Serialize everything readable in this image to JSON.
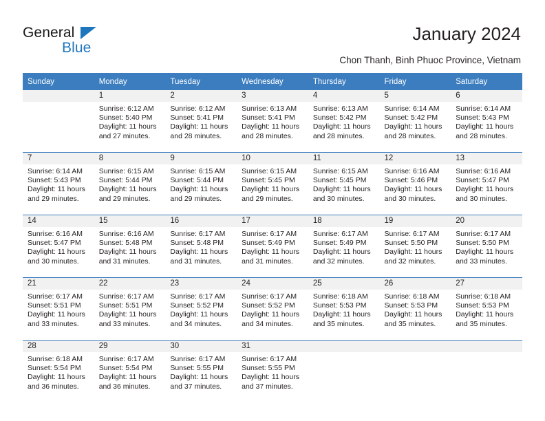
{
  "brand": {
    "name_part1": "General",
    "name_part2": "Blue",
    "triangle_color": "#1e76bd"
  },
  "header": {
    "title": "January 2024",
    "subtitle": "Chon Thanh, Binh Phuoc Province, Vietnam"
  },
  "theme": {
    "header_blue": "#3b7dbf",
    "daynum_band": "#f1f1f1",
    "text": "#231f20"
  },
  "calendar": {
    "weekday_headers": [
      "Sunday",
      "Monday",
      "Tuesday",
      "Wednesday",
      "Thursday",
      "Friday",
      "Saturday"
    ],
    "weeks": [
      [
        {
          "day": "",
          "sunrise": "",
          "sunset": "",
          "daylight1": "",
          "daylight2": ""
        },
        {
          "day": "1",
          "sunrise": "Sunrise: 6:12 AM",
          "sunset": "Sunset: 5:40 PM",
          "daylight1": "Daylight: 11 hours",
          "daylight2": "and 27 minutes."
        },
        {
          "day": "2",
          "sunrise": "Sunrise: 6:12 AM",
          "sunset": "Sunset: 5:41 PM",
          "daylight1": "Daylight: 11 hours",
          "daylight2": "and 28 minutes."
        },
        {
          "day": "3",
          "sunrise": "Sunrise: 6:13 AM",
          "sunset": "Sunset: 5:41 PM",
          "daylight1": "Daylight: 11 hours",
          "daylight2": "and 28 minutes."
        },
        {
          "day": "4",
          "sunrise": "Sunrise: 6:13 AM",
          "sunset": "Sunset: 5:42 PM",
          "daylight1": "Daylight: 11 hours",
          "daylight2": "and 28 minutes."
        },
        {
          "day": "5",
          "sunrise": "Sunrise: 6:14 AM",
          "sunset": "Sunset: 5:42 PM",
          "daylight1": "Daylight: 11 hours",
          "daylight2": "and 28 minutes."
        },
        {
          "day": "6",
          "sunrise": "Sunrise: 6:14 AM",
          "sunset": "Sunset: 5:43 PM",
          "daylight1": "Daylight: 11 hours",
          "daylight2": "and 28 minutes."
        }
      ],
      [
        {
          "day": "7",
          "sunrise": "Sunrise: 6:14 AM",
          "sunset": "Sunset: 5:43 PM",
          "daylight1": "Daylight: 11 hours",
          "daylight2": "and 29 minutes."
        },
        {
          "day": "8",
          "sunrise": "Sunrise: 6:15 AM",
          "sunset": "Sunset: 5:44 PM",
          "daylight1": "Daylight: 11 hours",
          "daylight2": "and 29 minutes."
        },
        {
          "day": "9",
          "sunrise": "Sunrise: 6:15 AM",
          "sunset": "Sunset: 5:44 PM",
          "daylight1": "Daylight: 11 hours",
          "daylight2": "and 29 minutes."
        },
        {
          "day": "10",
          "sunrise": "Sunrise: 6:15 AM",
          "sunset": "Sunset: 5:45 PM",
          "daylight1": "Daylight: 11 hours",
          "daylight2": "and 29 minutes."
        },
        {
          "day": "11",
          "sunrise": "Sunrise: 6:15 AM",
          "sunset": "Sunset: 5:45 PM",
          "daylight1": "Daylight: 11 hours",
          "daylight2": "and 30 minutes."
        },
        {
          "day": "12",
          "sunrise": "Sunrise: 6:16 AM",
          "sunset": "Sunset: 5:46 PM",
          "daylight1": "Daylight: 11 hours",
          "daylight2": "and 30 minutes."
        },
        {
          "day": "13",
          "sunrise": "Sunrise: 6:16 AM",
          "sunset": "Sunset: 5:47 PM",
          "daylight1": "Daylight: 11 hours",
          "daylight2": "and 30 minutes."
        }
      ],
      [
        {
          "day": "14",
          "sunrise": "Sunrise: 6:16 AM",
          "sunset": "Sunset: 5:47 PM",
          "daylight1": "Daylight: 11 hours",
          "daylight2": "and 30 minutes."
        },
        {
          "day": "15",
          "sunrise": "Sunrise: 6:16 AM",
          "sunset": "Sunset: 5:48 PM",
          "daylight1": "Daylight: 11 hours",
          "daylight2": "and 31 minutes."
        },
        {
          "day": "16",
          "sunrise": "Sunrise: 6:17 AM",
          "sunset": "Sunset: 5:48 PM",
          "daylight1": "Daylight: 11 hours",
          "daylight2": "and 31 minutes."
        },
        {
          "day": "17",
          "sunrise": "Sunrise: 6:17 AM",
          "sunset": "Sunset: 5:49 PM",
          "daylight1": "Daylight: 11 hours",
          "daylight2": "and 31 minutes."
        },
        {
          "day": "18",
          "sunrise": "Sunrise: 6:17 AM",
          "sunset": "Sunset: 5:49 PM",
          "daylight1": "Daylight: 11 hours",
          "daylight2": "and 32 minutes."
        },
        {
          "day": "19",
          "sunrise": "Sunrise: 6:17 AM",
          "sunset": "Sunset: 5:50 PM",
          "daylight1": "Daylight: 11 hours",
          "daylight2": "and 32 minutes."
        },
        {
          "day": "20",
          "sunrise": "Sunrise: 6:17 AM",
          "sunset": "Sunset: 5:50 PM",
          "daylight1": "Daylight: 11 hours",
          "daylight2": "and 33 minutes."
        }
      ],
      [
        {
          "day": "21",
          "sunrise": "Sunrise: 6:17 AM",
          "sunset": "Sunset: 5:51 PM",
          "daylight1": "Daylight: 11 hours",
          "daylight2": "and 33 minutes."
        },
        {
          "day": "22",
          "sunrise": "Sunrise: 6:17 AM",
          "sunset": "Sunset: 5:51 PM",
          "daylight1": "Daylight: 11 hours",
          "daylight2": "and 33 minutes."
        },
        {
          "day": "23",
          "sunrise": "Sunrise: 6:17 AM",
          "sunset": "Sunset: 5:52 PM",
          "daylight1": "Daylight: 11 hours",
          "daylight2": "and 34 minutes."
        },
        {
          "day": "24",
          "sunrise": "Sunrise: 6:17 AM",
          "sunset": "Sunset: 5:52 PM",
          "daylight1": "Daylight: 11 hours",
          "daylight2": "and 34 minutes."
        },
        {
          "day": "25",
          "sunrise": "Sunrise: 6:18 AM",
          "sunset": "Sunset: 5:53 PM",
          "daylight1": "Daylight: 11 hours",
          "daylight2": "and 35 minutes."
        },
        {
          "day": "26",
          "sunrise": "Sunrise: 6:18 AM",
          "sunset": "Sunset: 5:53 PM",
          "daylight1": "Daylight: 11 hours",
          "daylight2": "and 35 minutes."
        },
        {
          "day": "27",
          "sunrise": "Sunrise: 6:18 AM",
          "sunset": "Sunset: 5:53 PM",
          "daylight1": "Daylight: 11 hours",
          "daylight2": "and 35 minutes."
        }
      ],
      [
        {
          "day": "28",
          "sunrise": "Sunrise: 6:18 AM",
          "sunset": "Sunset: 5:54 PM",
          "daylight1": "Daylight: 11 hours",
          "daylight2": "and 36 minutes."
        },
        {
          "day": "29",
          "sunrise": "Sunrise: 6:17 AM",
          "sunset": "Sunset: 5:54 PM",
          "daylight1": "Daylight: 11 hours",
          "daylight2": "and 36 minutes."
        },
        {
          "day": "30",
          "sunrise": "Sunrise: 6:17 AM",
          "sunset": "Sunset: 5:55 PM",
          "daylight1": "Daylight: 11 hours",
          "daylight2": "and 37 minutes."
        },
        {
          "day": "31",
          "sunrise": "Sunrise: 6:17 AM",
          "sunset": "Sunset: 5:55 PM",
          "daylight1": "Daylight: 11 hours",
          "daylight2": "and 37 minutes."
        },
        {
          "day": "",
          "sunrise": "",
          "sunset": "",
          "daylight1": "",
          "daylight2": ""
        },
        {
          "day": "",
          "sunrise": "",
          "sunset": "",
          "daylight1": "",
          "daylight2": ""
        },
        {
          "day": "",
          "sunrise": "",
          "sunset": "",
          "daylight1": "",
          "daylight2": ""
        }
      ]
    ]
  }
}
